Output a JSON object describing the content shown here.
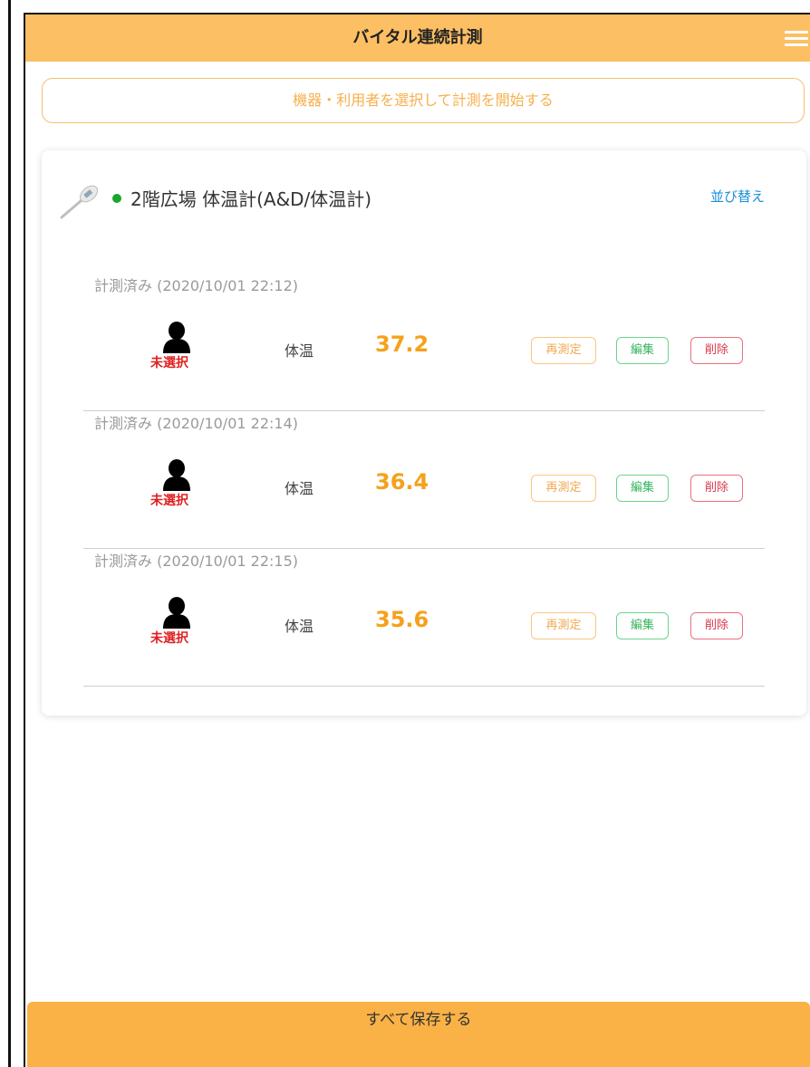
{
  "header": {
    "title": "バイタル連続計測"
  },
  "start_button": {
    "label": "機器・利用者を選択して計測を開始する"
  },
  "device": {
    "name": "2階広場 体温計(A&D/体温計)",
    "sort_label": "並び替え"
  },
  "measurements": [
    {
      "time_label": "計測済み (2020/10/01 22:12)",
      "user_status": "未選択",
      "metric_label": "体温",
      "value": "37.2",
      "remeasure_label": "再測定",
      "edit_label": "編集",
      "delete_label": "削除"
    },
    {
      "time_label": "計測済み (2020/10/01 22:14)",
      "user_status": "未選択",
      "metric_label": "体温",
      "value": "36.4",
      "remeasure_label": "再測定",
      "edit_label": "編集",
      "delete_label": "削除"
    },
    {
      "time_label": "計測済み (2020/10/01 22:15)",
      "user_status": "未選択",
      "metric_label": "体温",
      "value": "35.6",
      "remeasure_label": "再測定",
      "edit_label": "編集",
      "delete_label": "削除"
    }
  ],
  "save_all": {
    "label": "すべて保存する"
  },
  "colors": {
    "header_bg": "#fcbf63",
    "save_bg": "#fab246",
    "value": "#f5a11b",
    "status_dot": "#1aa52b",
    "link": "#1a8ed8",
    "unselected": "#e02020"
  },
  "icons": {
    "thermometer": "thermometer-icon",
    "user": "user-silhouette-icon",
    "menu": "hamburger-menu-icon",
    "status": "status-dot"
  }
}
